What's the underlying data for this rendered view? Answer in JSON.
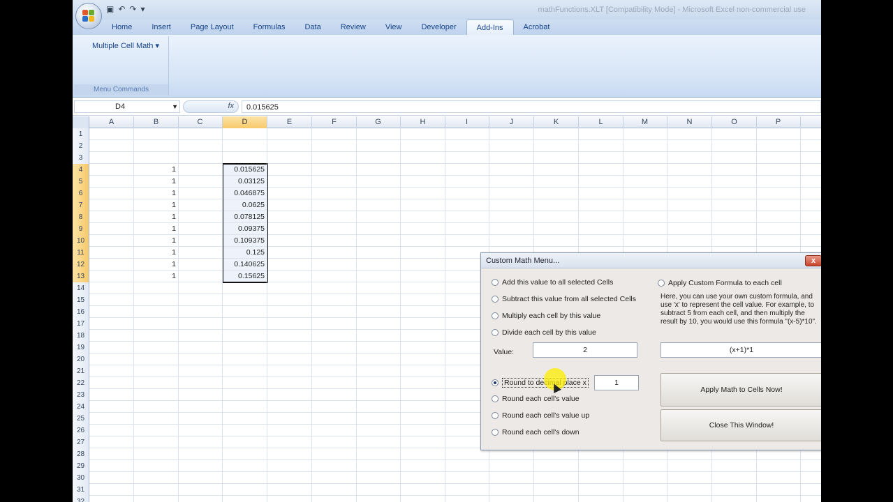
{
  "window": {
    "title": "mathFunctions.XLT  [Compatibility Mode] - Microsoft Excel non-commercial use"
  },
  "quick_access": [
    "save-icon",
    "undo-icon",
    "redo-icon",
    "customize-icon"
  ],
  "tabs": [
    "Home",
    "Insert",
    "Page Layout",
    "Formulas",
    "Data",
    "Review",
    "View",
    "Developer",
    "Add-Ins",
    "Acrobat"
  ],
  "active_tab": "Add-Ins",
  "ribbon": {
    "button_label": "Multiple Cell Math",
    "group_label": "Menu Commands"
  },
  "formula_bar": {
    "name_box": "D4",
    "fx_label": "fx",
    "value": "0.015625"
  },
  "grid": {
    "columns": [
      "A",
      "B",
      "C",
      "D",
      "E",
      "F",
      "G",
      "H",
      "I",
      "J",
      "K",
      "L",
      "M",
      "N",
      "O",
      "P"
    ],
    "selected_column": "D",
    "rows": [
      "1",
      "2",
      "3",
      "4",
      "5",
      "6",
      "7",
      "8",
      "9",
      "10",
      "11",
      "12",
      "13",
      "14",
      "15",
      "16",
      "17",
      "18",
      "19",
      "20",
      "21",
      "22",
      "23",
      "24",
      "25",
      "26",
      "27",
      "28",
      "29",
      "30",
      "31",
      "32"
    ],
    "selected_rows": [
      "4",
      "5",
      "6",
      "7",
      "8",
      "9",
      "10",
      "11",
      "12",
      "13"
    ],
    "column_b": [
      "1",
      "1",
      "1",
      "1",
      "1",
      "1",
      "1",
      "1",
      "1",
      "1"
    ],
    "column_d": [
      "0.015625",
      "0.03125",
      "0.046875",
      "0.0625",
      "0.078125",
      "0.09375",
      "0.109375",
      "0.125",
      "0.140625",
      "0.15625"
    ]
  },
  "dialog": {
    "title": "Custom Math Menu...",
    "close": "x",
    "options": {
      "add": "Add this value to all selected Cells",
      "subtract": "Subtract this value from all selected Cells",
      "multiply": "Multiply each cell by this value",
      "divide": "Divide each cell by this value",
      "custom": "Apply Custom Formula to each cell",
      "round_decimal": "Round to decimal place x",
      "round_value": "Round each cell's value",
      "round_up": "Round each cell's value up",
      "round_down": "Round each cell's down"
    },
    "help_text": "Here, you can use your own custom formula, and use 'x' to represent the cell value. For example, to subtract 5 from each cell, and then multiply the result by 10, you would use this formula \"(x-5)*10\".",
    "value_label": "Value:",
    "value": "2",
    "formula_value": "(x+1)*1",
    "decimal_value": "1",
    "apply_button": "Apply Math to Cells Now!",
    "close_button": "Close This Window!"
  }
}
